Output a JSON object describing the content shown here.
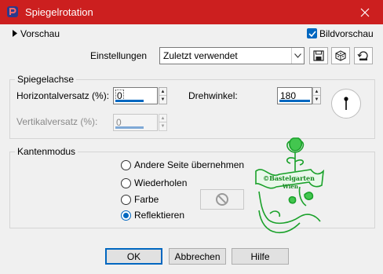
{
  "window": {
    "title": "Spiegelrotation",
    "app_icon": "paint-shop-pro-icon",
    "close_icon": "close-icon",
    "title_bar_color": "#cc1f1f"
  },
  "top": {
    "preview_label": "Vorschau",
    "preview_icon": "triangle-right-icon",
    "bildvorschau_label": "Bildvorschau",
    "bildvorschau_checked": true,
    "settings_label": "Einstellungen",
    "settings_value": "Zuletzt verwendet"
  },
  "toolbar_icons": [
    "save-preset-icon",
    "random-dice-icon",
    "reset-icon"
  ],
  "spiegelachse": {
    "title": "Spiegelachse",
    "horizontal_label": "Horizontalversatz (%):",
    "horizontal_value": "0",
    "vertical_label": "Vertikalversatz (%):",
    "vertical_value": "0",
    "drehwinkel_label": "Drehwinkel:",
    "drehwinkel_value": "180"
  },
  "kantenmodus": {
    "title": "Kantenmodus",
    "options": [
      "Andere Seite übernehmen",
      "Wiederholen",
      "Farbe",
      "Reflektieren"
    ],
    "selected": "Reflektieren"
  },
  "watermark": {
    "line1": "©Bastelgarten",
    "line2": "Wien",
    "color": "#1aa12a"
  },
  "buttons": {
    "ok": "OK",
    "cancel": "Abbrechen",
    "help": "Hilfe"
  },
  "colors": {
    "accent": "#0067c0"
  }
}
